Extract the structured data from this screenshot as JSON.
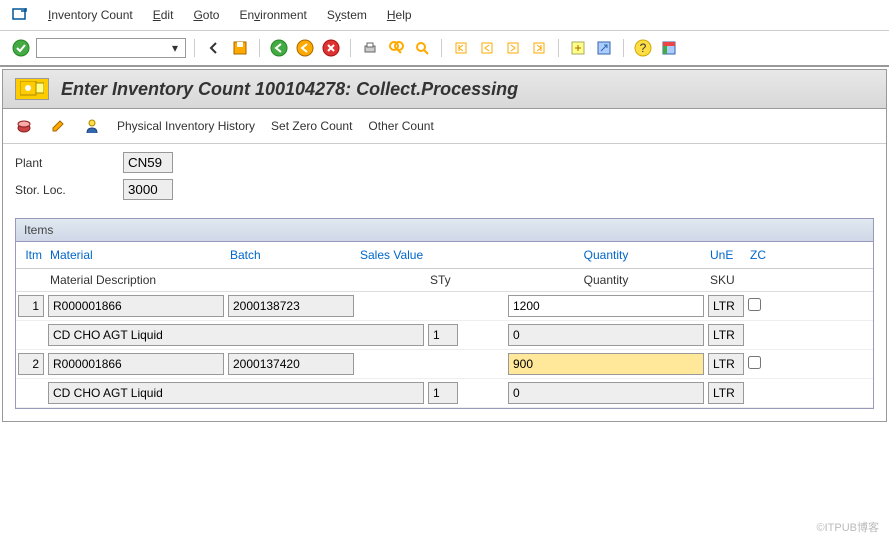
{
  "menu": {
    "inventory": "Inventory Count",
    "edit": "Edit",
    "goto": "Goto",
    "environment": "Environment",
    "system": "System",
    "help": "Help"
  },
  "title": "Enter Inventory Count 100104278: Collect.Processing",
  "actions": {
    "history": "Physical Inventory History",
    "zero": "Set Zero Count",
    "other": "Other Count"
  },
  "form": {
    "plant_label": "Plant",
    "plant_value": "CN59",
    "stor_label": "Stor. Loc.",
    "stor_value": "3000"
  },
  "items_header": "Items",
  "columns": {
    "itm": "Itm",
    "material": "Material",
    "batch": "Batch",
    "sales_value": "Sales Value",
    "quantity": "Quantity",
    "une": "UnE",
    "zc": "ZC",
    "mat_desc": "Material Description",
    "sty": "STy",
    "quantity2": "Quantity",
    "sku": "SKU"
  },
  "rows": [
    {
      "itm": "1",
      "material": "R000001866",
      "batch": "2000138723",
      "qty": "1200",
      "une": "LTR",
      "desc": "CD CHO AGT Liquid",
      "sty": "1",
      "qty2": "0",
      "une2": "LTR"
    },
    {
      "itm": "2",
      "material": "R000001866",
      "batch": "2000137420",
      "qty": "900",
      "une": "LTR",
      "desc": "CD CHO AGT Liquid",
      "sty": "1",
      "qty2": "0",
      "une2": "LTR"
    }
  ],
  "watermark": "©ITPUB博客"
}
